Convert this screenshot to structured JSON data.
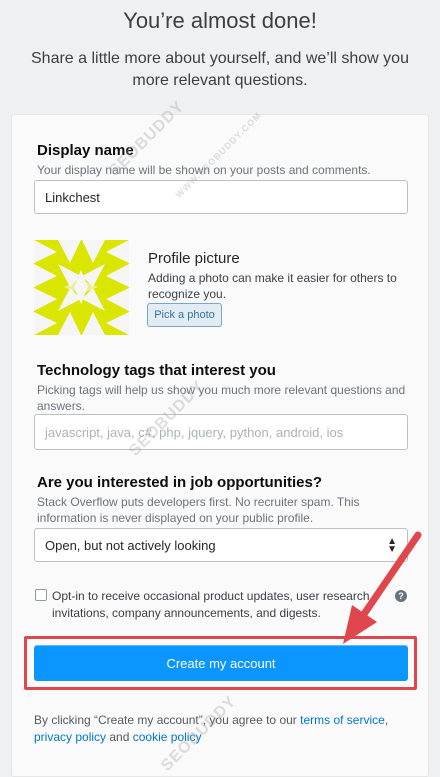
{
  "header": {
    "title": "You’re almost done!",
    "subtitle": "Share a little more about yourself, and we’ll show you more relevant questions."
  },
  "display_name": {
    "label": "Display name",
    "help": "Your display name will be shown on your posts and comments.",
    "value": "Linkchest"
  },
  "profile_picture": {
    "title": "Profile picture",
    "help": "Adding a photo can make it easier for others to recognize you.",
    "button_label": "Pick a photo"
  },
  "tags": {
    "label": "Technology tags that interest you",
    "help": "Picking tags will help us show you much more relevant questions and answers.",
    "placeholder": "javascript, java, c#, php, jquery, python, android, ios"
  },
  "jobs": {
    "label": "Are you interested in job opportunities?",
    "help": "Stack Overflow puts developers first. No recruiter spam. This information is never displayed on your public profile.",
    "selected": "Open, but not actively looking"
  },
  "opt_in": {
    "text": "Opt-in to receive occasional product updates, user research invitations, company announcements, and digests.",
    "help_icon": "?",
    "checked": false
  },
  "submit": {
    "label": "Create my account"
  },
  "legal": {
    "prefix": "By clicking “Create my account”, you agree to our",
    "terms_link": "terms of service",
    "privacy_link": "privacy policy",
    "and": "and",
    "cookie_link": "cookie policy"
  },
  "watermark": {
    "text": "SEOBUDDY",
    "url": "WWW.SEOBUDDY.COM"
  },
  "colors": {
    "accent": "#0a95ff",
    "highlight": "#e0474c",
    "avatar": "#dbe600"
  }
}
